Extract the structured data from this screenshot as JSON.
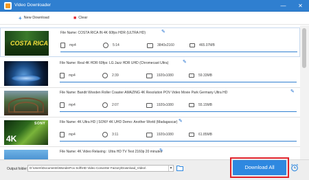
{
  "app": {
    "title": "Video Downloader"
  },
  "window_controls": {
    "minimize": "—",
    "maximize": "☐",
    "close": "✕"
  },
  "toolbar": {
    "new_download": "New Download",
    "clear": "Clear"
  },
  "items": [
    {
      "file_name": "File Name: COSTA RICA IN 4K 60fps HDR (ULTRA HD)",
      "format": "mp4",
      "duration": "5:14",
      "resolution": "3840x2160",
      "size": "465.07MB",
      "thumb_text": "COSTA RICA",
      "progress": 1.0
    },
    {
      "file_name": "File Name: Real 4K HDR 60fps: LG Jazz HDR UHD (Chromecast Ultra)",
      "format": "mp4",
      "duration": "2:39",
      "resolution": "1920x1080",
      "size": "59.33MB",
      "thumb_text": "",
      "progress": 1.0
    },
    {
      "file_name": "File Name: Bandit Wooden Roller Coaster AMAZING 4K Resolution POV Video Movie Park Germany Ultra HD",
      "format": "mp4",
      "duration": "2:07",
      "resolution": "1920x1080",
      "size": "55.15MB",
      "thumb_text": "",
      "progress": 1.0
    },
    {
      "file_name": "File Name: 4K Ultra HD | SONY 4K UHD Demo: Another World (Madagascar)",
      "format": "mp4",
      "duration": "3:11",
      "resolution": "1920x1080",
      "size": "61.85MB",
      "thumb_text": "SONY",
      "thumb_text2": "4K",
      "progress": 1.0
    },
    {
      "file_name": "File Name: 4K Video Relaxing : Ultra HD TV Test 2160p 20 minutes",
      "format": "mp4",
      "duration": "",
      "resolution": "",
      "size": "",
      "thumb_text": "",
      "progress": 1.0
    }
  ],
  "output": {
    "label": "Output folder:",
    "path": "D:\\Users\\Documents\\WonderFox Soft\\HD Video Converter Factory\\Download_Video\\"
  },
  "download_all": "Download All",
  "colors": {
    "accent": "#2e88e0",
    "titlebar": "#2f7fd0",
    "highlight": "#e0222a"
  }
}
